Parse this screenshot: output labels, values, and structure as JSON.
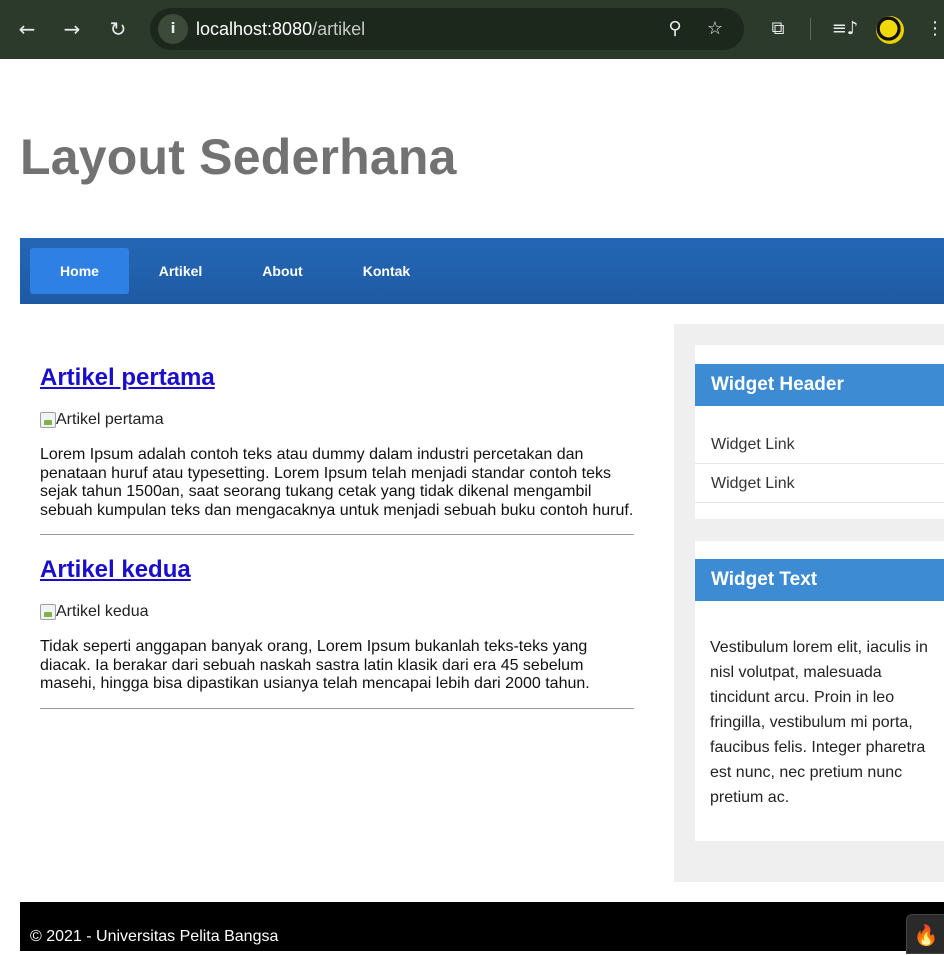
{
  "browser": {
    "url_host": "localhost:8080",
    "url_path": "/artikel",
    "back_icon": "←",
    "forward_icon": "→",
    "reload_icon": "↻",
    "info_icon": "i",
    "zoom_icon": "⚲",
    "star_icon": "☆",
    "extensions_icon": "⧉",
    "media_icon": "≡♪",
    "menu_icon": "⋮"
  },
  "site": {
    "title": "Layout Sederhana"
  },
  "nav": {
    "items": [
      {
        "label": "Home",
        "active": true
      },
      {
        "label": "Artikel",
        "active": false
      },
      {
        "label": "About",
        "active": false
      },
      {
        "label": "Kontak",
        "active": false
      }
    ]
  },
  "articles": [
    {
      "title": "Artikel pertama",
      "image_alt": "Artikel pertama",
      "text": "Lorem Ipsum adalah contoh teks atau dummy dalam industri percetakan dan penataan huruf atau typesetting. Lorem Ipsum telah menjadi standar contoh teks sejak tahun 1500an, saat seorang tukang cetak yang tidak dikenal mengambil sebuah kumpulan teks dan mengacaknya untuk menjadi sebuah buku contoh huruf."
    },
    {
      "title": "Artikel kedua",
      "image_alt": "Artikel kedua",
      "text": "Tidak seperti anggapan banyak orang, Lorem Ipsum bukanlah teks-teks yang diacak. Ia berakar dari sebuah naskah sastra latin klasik dari era 45 sebelum masehi, hingga bisa dipastikan usianya telah mencapai lebih dari 2000 tahun."
    }
  ],
  "sidebar": {
    "widget1": {
      "header": "Widget Header",
      "links": [
        "Widget Link",
        "Widget Link"
      ]
    },
    "widget2": {
      "header": "Widget Text",
      "text": "Vestibulum lorem elit, iaculis in nisl volutpat, malesuada tincidunt arcu. Proin in leo fringilla, vestibulum mi porta, faucibus felis. Integer pharetra est nunc, nec pretium nunc pretium ac."
    }
  },
  "footer": {
    "text": "© 2021 - Universitas Pelita Bangsa"
  },
  "colors": {
    "nav_bg": "#1f5aa3",
    "nav_active": "#2f80e4",
    "widget_header": "#3d8bd3",
    "title_gray": "#727272"
  }
}
